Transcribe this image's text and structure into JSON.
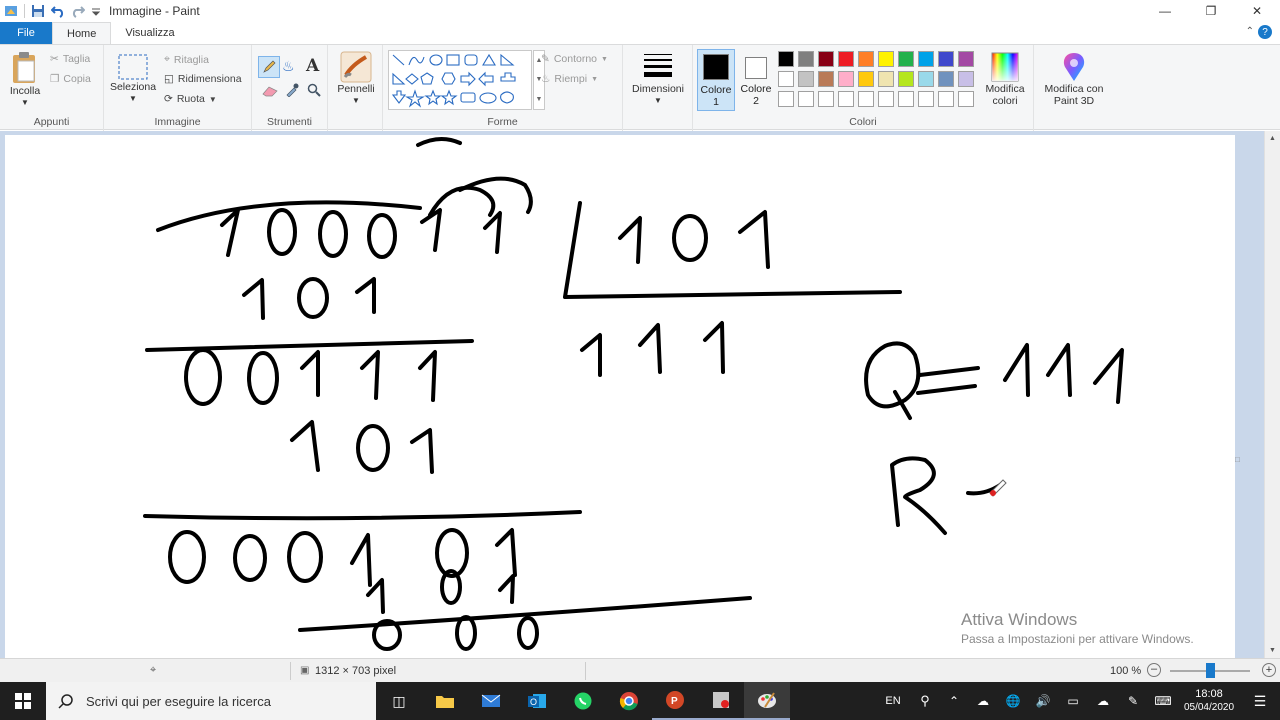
{
  "window": {
    "title": "Immagine - Paint"
  },
  "tabs": {
    "file": "File",
    "home": "Home",
    "view": "Visualizza"
  },
  "clipboard": {
    "paste": "Incolla",
    "cut": "Taglia",
    "copy": "Copia",
    "group": "Appunti"
  },
  "image": {
    "select": "Seleziona",
    "crop": "Ritaglia",
    "resize": "Ridimensiona",
    "rotate": "Ruota",
    "group": "Immagine"
  },
  "tools": {
    "group": "Strumenti",
    "text_icon": "A"
  },
  "brushes": {
    "label": "Pennelli"
  },
  "shapes": {
    "group": "Forme",
    "outline": "Contorno",
    "fill": "Riempi"
  },
  "size": {
    "label": "Dimensioni"
  },
  "colors": {
    "color1": "Colore\n1",
    "color1_a": "Colore",
    "color1_b": "1",
    "color2_a": "Colore",
    "color2_b": "2",
    "edit_a": "Modifica",
    "edit_b": "colori",
    "group": "Colori",
    "primary": "#000000",
    "secondary": "#ffffff",
    "palette_row1": [
      "#000000",
      "#7f7f7f",
      "#880015",
      "#ed1c24",
      "#ff7f27",
      "#fff200",
      "#22b14c",
      "#00a2e8",
      "#3f48cc",
      "#a349a4"
    ],
    "palette_row2": [
      "#ffffff",
      "#c3c3c3",
      "#b97a57",
      "#ffaec9",
      "#ffc90e",
      "#efe4b0",
      "#b5e61d",
      "#99d9ea",
      "#7092be",
      "#c8bfe7"
    ]
  },
  "paint3d": {
    "a": "Modifica con",
    "b": "Paint 3D"
  },
  "status": {
    "dimensions": "1312 × 703 pixel",
    "zoom": "100 %"
  },
  "watermark": {
    "line1": "Attiva Windows",
    "line2": "Passa a Impostazioni per attivare Windows."
  },
  "taskbar": {
    "search_placeholder": "Scrivi qui per eseguire la ricerca",
    "lang": "EN",
    "time": "18:08",
    "date": "05/04/2020"
  }
}
